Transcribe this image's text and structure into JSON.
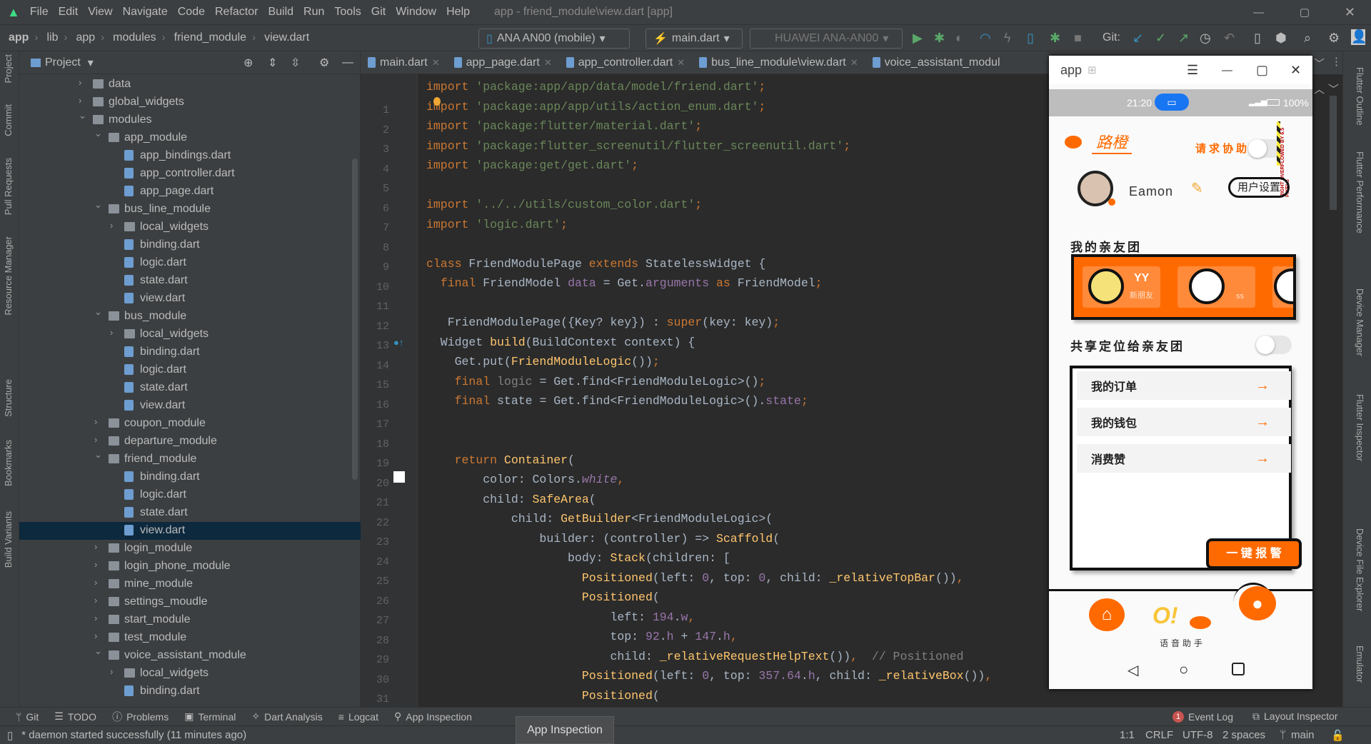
{
  "menubar": {
    "items": [
      "File",
      "Edit",
      "View",
      "Navigate",
      "Code",
      "Refactor",
      "Build",
      "Run",
      "Tools",
      "Git",
      "Window",
      "Help"
    ],
    "title": "app - friend_module\\view.dart [app]"
  },
  "navbar": {
    "breadcrumb": [
      "app",
      "lib",
      "app",
      "modules",
      "friend_module",
      "view.dart"
    ],
    "device": "ANA AN00 (mobile)",
    "run_config": "main.dart",
    "target": "HUAWEI ANA-AN00",
    "git_label": "Git:"
  },
  "left_strip": [
    "Project",
    "Commit",
    "Pull Requests",
    "Resource Manager",
    "Structure",
    "Bookmarks",
    "Build Variants"
  ],
  "right_strip": [
    "Flutter Outline",
    "Flutter Performance",
    "Device Manager",
    "Flutter Inspector",
    "Device File Explorer",
    "Emulator"
  ],
  "project": {
    "title": "Project",
    "tree": [
      {
        "label": "data",
        "level": 1,
        "type": "folder",
        "open": false
      },
      {
        "label": "global_widgets",
        "level": 1,
        "type": "folder",
        "open": false
      },
      {
        "label": "modules",
        "level": 1,
        "type": "folder",
        "open": true
      },
      {
        "label": "app_module",
        "level": 2,
        "type": "folder",
        "open": true
      },
      {
        "label": "app_bindings.dart",
        "level": 3,
        "type": "file"
      },
      {
        "label": "app_controller.dart",
        "level": 3,
        "type": "file"
      },
      {
        "label": "app_page.dart",
        "level": 3,
        "type": "file"
      },
      {
        "label": "bus_line_module",
        "level": 2,
        "type": "folder",
        "open": true
      },
      {
        "label": "local_widgets",
        "level": 3,
        "type": "folder",
        "open": false
      },
      {
        "label": "binding.dart",
        "level": 3,
        "type": "file"
      },
      {
        "label": "logic.dart",
        "level": 3,
        "type": "file"
      },
      {
        "label": "state.dart",
        "level": 3,
        "type": "file"
      },
      {
        "label": "view.dart",
        "level": 3,
        "type": "file"
      },
      {
        "label": "bus_module",
        "level": 2,
        "type": "folder",
        "open": true
      },
      {
        "label": "local_widgets",
        "level": 3,
        "type": "folder",
        "open": false
      },
      {
        "label": "binding.dart",
        "level": 3,
        "type": "file"
      },
      {
        "label": "logic.dart",
        "level": 3,
        "type": "file"
      },
      {
        "label": "state.dart",
        "level": 3,
        "type": "file"
      },
      {
        "label": "view.dart",
        "level": 3,
        "type": "file"
      },
      {
        "label": "coupon_module",
        "level": 2,
        "type": "folder",
        "open": false
      },
      {
        "label": "departure_module",
        "level": 2,
        "type": "folder",
        "open": false
      },
      {
        "label": "friend_module",
        "level": 2,
        "type": "folder",
        "open": true
      },
      {
        "label": "binding.dart",
        "level": 3,
        "type": "file"
      },
      {
        "label": "logic.dart",
        "level": 3,
        "type": "file"
      },
      {
        "label": "state.dart",
        "level": 3,
        "type": "file"
      },
      {
        "label": "view.dart",
        "level": 3,
        "type": "file",
        "selected": true
      },
      {
        "label": "login_module",
        "level": 2,
        "type": "folder",
        "open": false
      },
      {
        "label": "login_phone_module",
        "level": 2,
        "type": "folder",
        "open": false
      },
      {
        "label": "mine_module",
        "level": 2,
        "type": "folder",
        "open": false
      },
      {
        "label": "settings_moudle",
        "level": 2,
        "type": "folder",
        "open": false
      },
      {
        "label": "start_module",
        "level": 2,
        "type": "folder",
        "open": false
      },
      {
        "label": "test_module",
        "level": 2,
        "type": "folder",
        "open": false
      },
      {
        "label": "voice_assistant_module",
        "level": 2,
        "type": "folder",
        "open": true
      },
      {
        "label": "local_widgets",
        "level": 3,
        "type": "folder",
        "open": false
      },
      {
        "label": "binding.dart",
        "level": 3,
        "type": "file"
      }
    ]
  },
  "editor": {
    "tabs": [
      "main.dart",
      "app_page.dart",
      "app_controller.dart",
      "bus_line_module\\view.dart",
      "voice_assistant_modul"
    ],
    "lines": [
      [
        [
          "k",
          "import "
        ],
        [
          "s",
          "'package:app/app/data/model/friend.dart'"
        ],
        [
          "k",
          ";"
        ]
      ],
      [
        [
          "k",
          "import "
        ],
        [
          "s",
          "'package:app/app/utils/action_enum.dart'"
        ],
        [
          "k",
          ";"
        ]
      ],
      [
        [
          "k",
          "import "
        ],
        [
          "s",
          "'package:flutter/material.dart'"
        ],
        [
          "k",
          ";"
        ]
      ],
      [
        [
          "k",
          "import "
        ],
        [
          "s",
          "'package:flutter_screenutil/flutter_screenutil.dart'"
        ],
        [
          "k",
          ";"
        ]
      ],
      [
        [
          "k",
          "import "
        ],
        [
          "s",
          "'package:get/get.dart'"
        ],
        [
          "k",
          ";"
        ]
      ],
      [],
      [
        [
          "k",
          "import "
        ],
        [
          "s",
          "'../../utils/custom_color.dart'"
        ],
        [
          "k",
          ";"
        ]
      ],
      [
        [
          "k",
          "import "
        ],
        [
          "s",
          "'logic.dart'"
        ],
        [
          "k",
          ";"
        ]
      ],
      [],
      [
        [
          "k",
          "class "
        ],
        [
          "d",
          "FriendModulePage "
        ],
        [
          "k",
          "extends "
        ],
        [
          "d",
          "StatelessWidget {"
        ]
      ],
      [
        [
          "d",
          "  "
        ],
        [
          "k",
          "final "
        ],
        [
          "d",
          "FriendModel "
        ],
        [
          "p",
          "data"
        ],
        [
          "d",
          " = Get."
        ],
        [
          "p",
          "arguments"
        ],
        [
          "k",
          " as "
        ],
        [
          "d",
          "FriendModel"
        ],
        [
          "k",
          ";"
        ]
      ],
      [],
      [
        [
          "d",
          "   FriendModulePage({Key? key}) : "
        ],
        [
          "k",
          "super"
        ],
        [
          "d",
          "(key: key)"
        ],
        [
          "k",
          ";"
        ]
      ],
      [
        [
          "d",
          "  Widget "
        ],
        [
          "f",
          "build"
        ],
        [
          "d",
          "(BuildContext context) {"
        ]
      ],
      [
        [
          "d",
          "    Get.put("
        ],
        [
          "f",
          "FriendModuleLogic"
        ],
        [
          "d",
          "())"
        ],
        [
          "k",
          ";"
        ]
      ],
      [
        [
          "d",
          "    "
        ],
        [
          "k",
          "final "
        ],
        [
          "c",
          "logic"
        ],
        [
          "d",
          " = Get.find<FriendModuleLogic>()"
        ],
        [
          "k",
          ";"
        ]
      ],
      [
        [
          "d",
          "    "
        ],
        [
          "k",
          "final "
        ],
        [
          "d",
          "state = Get.find<FriendModuleLogic>()."
        ],
        [
          "p",
          "state"
        ],
        [
          "k",
          ";"
        ]
      ],
      [],
      [],
      [
        [
          "d",
          "    "
        ],
        [
          "k",
          "return "
        ],
        [
          "f",
          "Container"
        ],
        [
          "d",
          "("
        ]
      ],
      [
        [
          "d",
          "        color: Colors."
        ],
        [
          "pi",
          "white"
        ],
        [
          "k",
          ","
        ]
      ],
      [
        [
          "d",
          "        child: "
        ],
        [
          "f",
          "SafeArea"
        ],
        [
          "d",
          "("
        ]
      ],
      [
        [
          "d",
          "            child: "
        ],
        [
          "f",
          "GetBuilder"
        ],
        [
          "d",
          "<FriendModuleLogic>("
        ]
      ],
      [
        [
          "d",
          "                builder: (controller) => "
        ],
        [
          "f",
          "Scaffold"
        ],
        [
          "d",
          "("
        ]
      ],
      [
        [
          "d",
          "                    body: "
        ],
        [
          "f",
          "Stack"
        ],
        [
          "d",
          "(children: ["
        ]
      ],
      [
        [
          "d",
          "                      "
        ],
        [
          "f",
          "Positioned"
        ],
        [
          "d",
          "(left: "
        ],
        [
          "p",
          "0"
        ],
        [
          "d",
          ", top: "
        ],
        [
          "p",
          "0"
        ],
        [
          "d",
          ", child: "
        ],
        [
          "f",
          "_relativeTopBar"
        ],
        [
          "d",
          "())"
        ],
        [
          "k",
          ","
        ]
      ],
      [
        [
          "d",
          "                      "
        ],
        [
          "f",
          "Positioned"
        ],
        [
          "d",
          "("
        ]
      ],
      [
        [
          "d",
          "                          left: "
        ],
        [
          "p",
          "194"
        ],
        [
          "d",
          "."
        ],
        [
          "p",
          "w"
        ],
        [
          "k",
          ","
        ]
      ],
      [
        [
          "d",
          "                          top: "
        ],
        [
          "p",
          "92"
        ],
        [
          "d",
          "."
        ],
        [
          "p",
          "h"
        ],
        [
          "d",
          " + "
        ],
        [
          "p",
          "147"
        ],
        [
          "d",
          "."
        ],
        [
          "p",
          "h"
        ],
        [
          "k",
          ","
        ]
      ],
      [
        [
          "d",
          "                          child: "
        ],
        [
          "f",
          "_relativeRequestHelpText"
        ],
        [
          "d",
          "())"
        ],
        [
          "k",
          ","
        ],
        [
          "c",
          "  // Positioned"
        ]
      ],
      [
        [
          "d",
          "                      "
        ],
        [
          "f",
          "Positioned"
        ],
        [
          "d",
          "(left: "
        ],
        [
          "p",
          "0"
        ],
        [
          "d",
          ", top: "
        ],
        [
          "p",
          "357.64"
        ],
        [
          "d",
          "."
        ],
        [
          "p",
          "h"
        ],
        [
          "d",
          ", child: "
        ],
        [
          "f",
          "_relativeBox"
        ],
        [
          "d",
          "())"
        ],
        [
          "k",
          ","
        ]
      ],
      [
        [
          "d",
          "                      "
        ],
        [
          "f",
          "Positioned"
        ],
        [
          "d",
          "("
        ]
      ]
    ]
  },
  "phone": {
    "window_title": "app",
    "time": "21:20",
    "battery": "100%",
    "logo": "路橙",
    "help_label": "请求协助",
    "overflow_text": "RIGHT OVERFLOWED BY 6.5 PIXELS",
    "username": "Eamon",
    "settings_button": "用户设置",
    "friends_title": "我的亲友团",
    "friends": [
      {
        "name": "YY",
        "sub": "新朋友"
      },
      {
        "name": "",
        "sub": "ss"
      }
    ],
    "share_label": "共享定位给亲友团",
    "share_on": false,
    "help_on": false,
    "menu": [
      "我的订单",
      "我的钱包",
      "消费赞"
    ],
    "sos_button": "一 键 报 警",
    "voice_label": "语音助手",
    "voice_logo": "O!",
    "accent": "#ff6a00"
  },
  "bottombar": {
    "tools": [
      "Git",
      "TODO",
      "Problems",
      "Terminal",
      "Dart Analysis",
      "Logcat",
      "App Inspection"
    ],
    "event_log": "Event Log",
    "event_count": "1",
    "layout_inspector": "Layout Inspector"
  },
  "tooltip": "App Inspection",
  "statusbar": {
    "message": "* daemon started successfully (11 minutes ago)",
    "position": "1:1",
    "line_sep": "CRLF",
    "encoding": "UTF-8",
    "indent": "2 spaces",
    "branch": "main"
  }
}
